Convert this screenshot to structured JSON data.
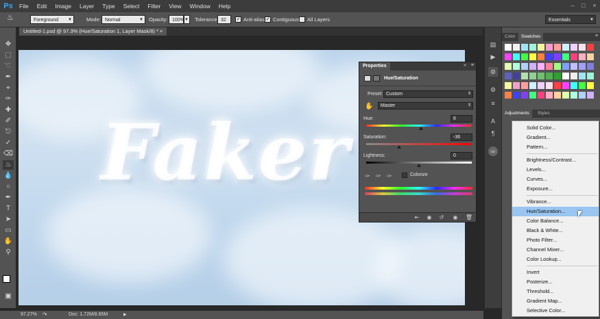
{
  "menubar": {
    "logo": "Ps",
    "items": [
      "File",
      "Edit",
      "Image",
      "Layer",
      "Type",
      "Select",
      "Filter",
      "View",
      "Window",
      "Help"
    ]
  },
  "options": {
    "sample": "Foreground",
    "mode_label": "Mode:",
    "mode_value": "Normal",
    "opacity_label": "Opacity:",
    "opacity_value": "100%",
    "tolerance_label": "Tolerance:",
    "tolerance_value": "32",
    "antialias": "Anti-alias",
    "contiguous": "Contiguous",
    "all_layers": "All Layers",
    "workspace": "Essentials"
  },
  "document": {
    "tab_title": "Untitled-1.psd @ 97.3% (Hue/Saturation 1, Layer Mask/8) *",
    "canvas_text": "Faker"
  },
  "status": {
    "zoom": "97.27%",
    "doc": "Doc: 1.72M/8.85M"
  },
  "properties": {
    "tab": "Properties",
    "title": "Hue/Saturation",
    "preset_label": "Preset:",
    "preset_value": "Custom",
    "channel": "Master",
    "hue_label": "Hue:",
    "hue_value": "6",
    "sat_label": "Saturation:",
    "sat_value": "-36",
    "light_label": "Lightness:",
    "light_value": "0",
    "colorize": "Colorize"
  },
  "right_panel": {
    "tab_color": "Color",
    "tab_swatches": "Swatches",
    "tab_adjustments": "Adjustments",
    "tab_styles": "Styles"
  },
  "adj_menu": {
    "items": [
      "Solid Color...",
      "Gradient...",
      "Pattern...",
      "Brightness/Contrast...",
      "Levels...",
      "Curves...",
      "Exposure...",
      "Vibrance...",
      "Hue/Saturation...",
      "Color Balance...",
      "Black & White...",
      "Photo Filter...",
      "Channel Mixer...",
      "Color Lookup...",
      "Invert",
      "Posterize...",
      "Threshold...",
      "Gradient Map...",
      "Selective Color..."
    ],
    "selected": "Hue/Saturation..."
  },
  "colors": {
    "accent": "#31a8ff",
    "selection": "#99c5f0",
    "panel": "#535353"
  }
}
